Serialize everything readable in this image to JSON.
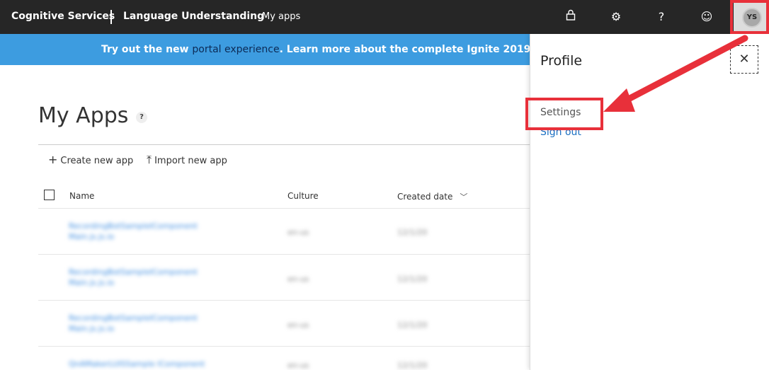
{
  "topbar": {
    "brand": "Cognitive Services",
    "product": "Language Understanding",
    "nav_my_apps": "My apps",
    "icons": [
      "lock-icon",
      "gear-icon",
      "help-icon",
      "smiley-icon"
    ],
    "avatar_initials": "YS"
  },
  "banner": {
    "text_prefix": "Try out the new ",
    "link_text": "portal experience",
    "text_suffix": ". Learn more about the complete Ignite 2019"
  },
  "main": {
    "title": "My Apps",
    "help_badge": "?",
    "actions": {
      "create": "Create new app",
      "import": "Import new app"
    },
    "columns": {
      "name": "Name",
      "culture": "Culture",
      "created": "Created date"
    },
    "rows": [
      {
        "name_line1": "RecordingBotSampleIComponent",
        "name_line2": "Main.js.js.io",
        "culture": "en-us",
        "date": "12/1/20"
      },
      {
        "name_line1": "RecordingBotSampleIComponent",
        "name_line2": "Main.js.js.io",
        "culture": "en-us",
        "date": "12/1/20"
      },
      {
        "name_line1": "RecordingBotSampleIComponent",
        "name_line2": "Main.js.js.io",
        "culture": "en-us",
        "date": "12/1/20"
      },
      {
        "name_line1": "QnAMakerLUISSample IComponent",
        "name_line2": "",
        "culture": "en-us",
        "date": "12/1/20"
      }
    ]
  },
  "profile_panel": {
    "title": "Profile",
    "settings": "Settings",
    "sign_out": "Sign out",
    "close_icon": "close-icon"
  },
  "colors": {
    "topbar": "#262626",
    "banner": "#3d9ce0",
    "highlight": "#e8303a",
    "link": "#1a6fc2"
  }
}
